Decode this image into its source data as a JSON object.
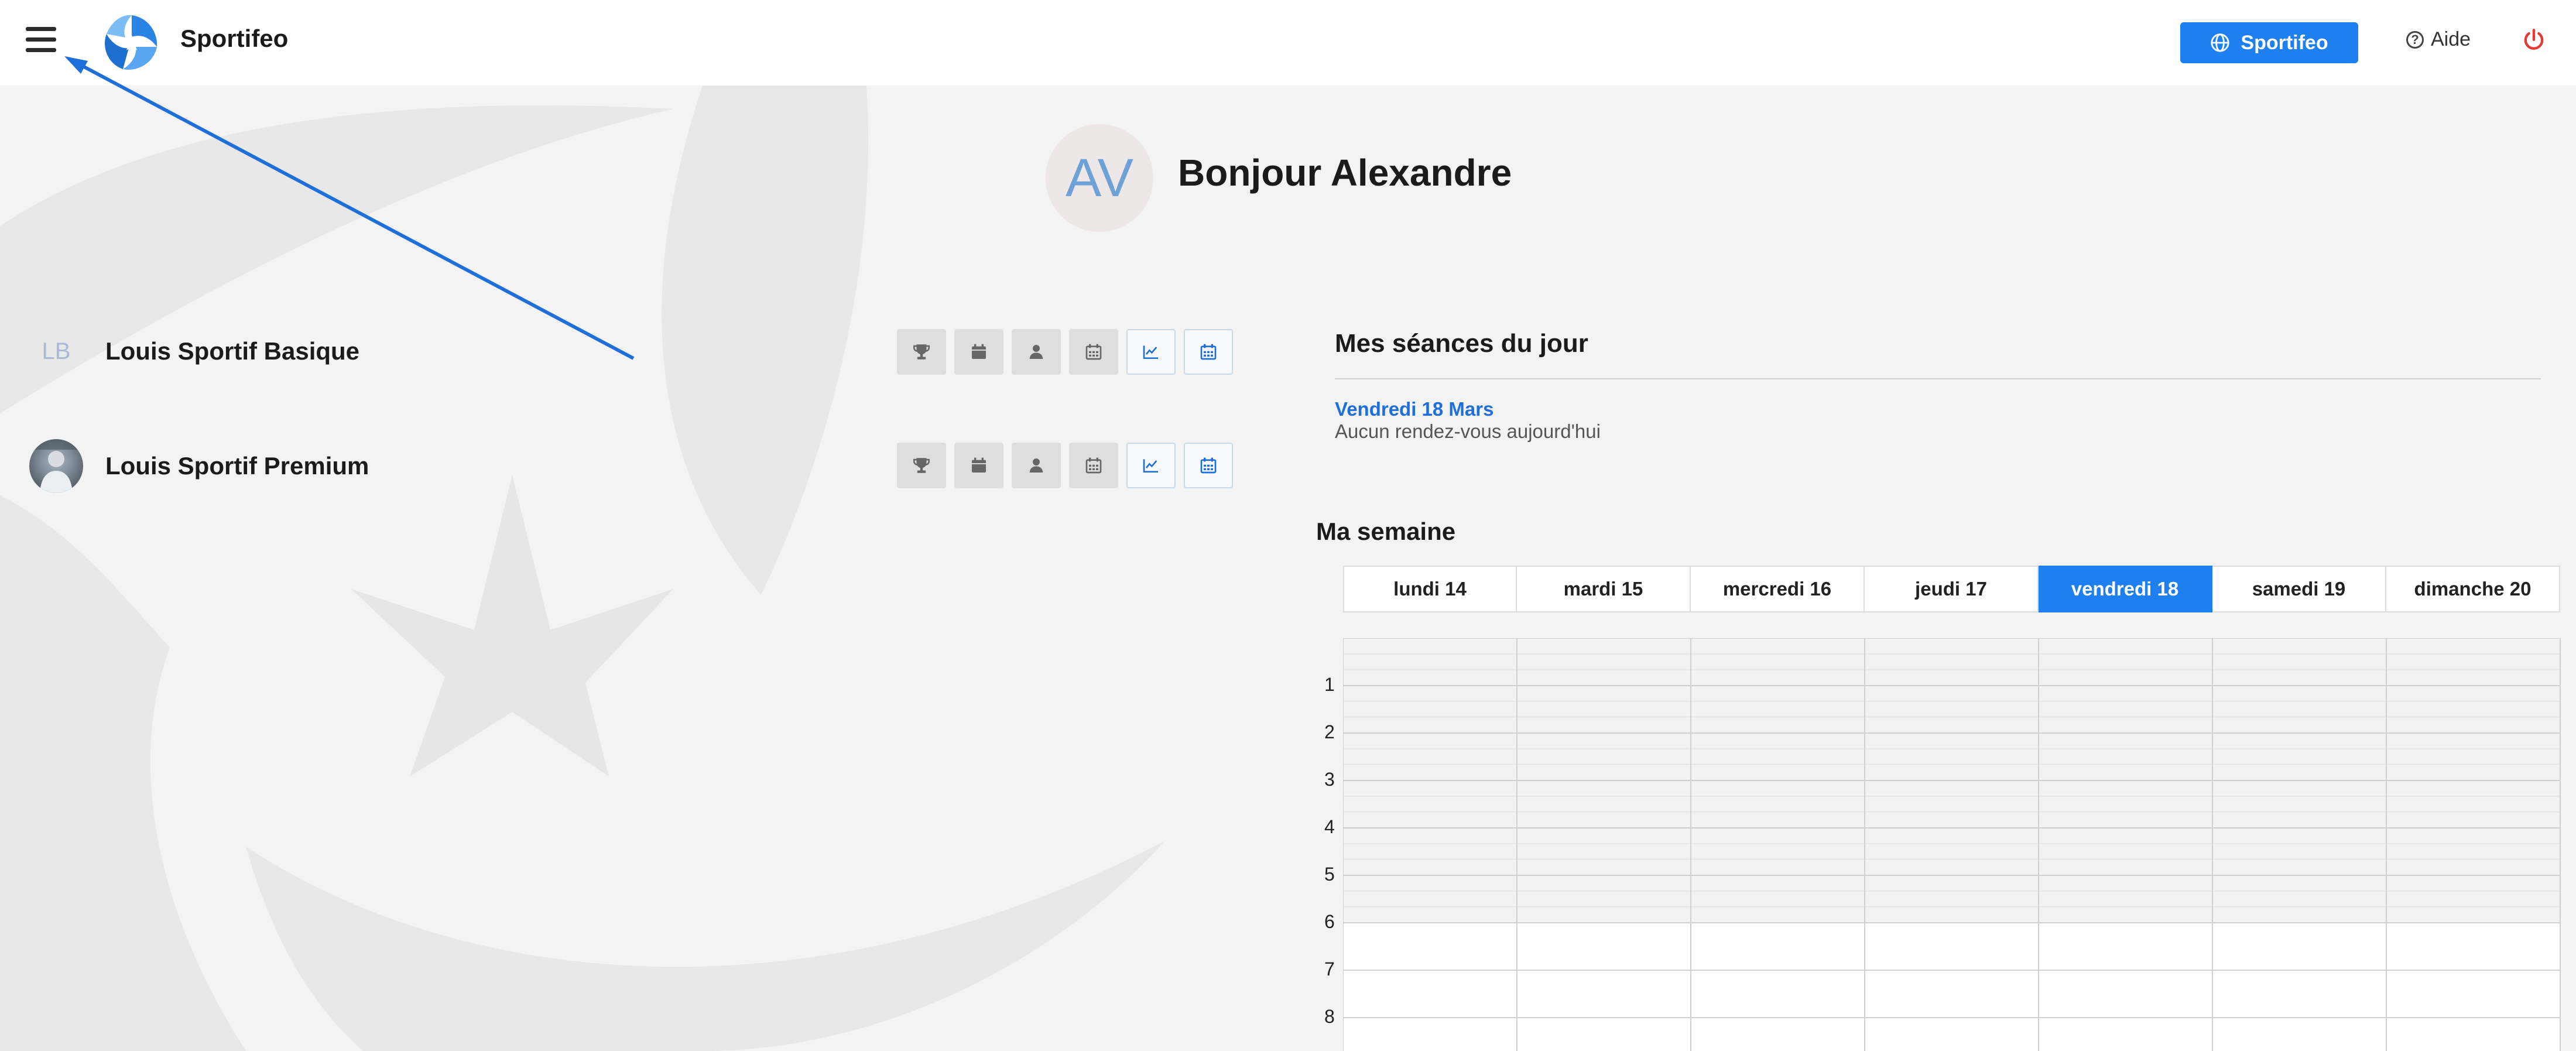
{
  "header": {
    "brand": "Sportifeo",
    "brand_button": "Sportifeo",
    "help": "Aide"
  },
  "greeting": {
    "initials": "AV",
    "title": "Bonjour Alexandre"
  },
  "athletes": [
    {
      "initials": "LB",
      "name": "Louis Sportif Basique"
    },
    {
      "initials": "",
      "name": "Louis Sportif Premium"
    }
  ],
  "day": {
    "title": "Mes séances du jour",
    "date": "Vendredi 18 Mars",
    "none": "Aucun rendez-vous aujourd'hui"
  },
  "week": {
    "title": "Ma semaine",
    "days": [
      "lundi 14",
      "mardi 15",
      "mercredi 16",
      "jeudi 17",
      "vendredi 18",
      "samedi 19",
      "dimanche 20"
    ],
    "active_day": "vendredi 18",
    "hours": [
      "1",
      "2",
      "3",
      "4",
      "5",
      "6",
      "7",
      "8"
    ]
  },
  "colors": {
    "accent": "#1e7ff0",
    "link": "#1e6fd9",
    "power": "#e53935"
  },
  "icons": [
    "menu-icon",
    "globe-icon",
    "help-icon",
    "power-icon",
    "trophy-icon",
    "calendar-icon",
    "user-icon",
    "calendar-grid-icon",
    "chart-line-icon",
    "calendar-blue-icon"
  ]
}
